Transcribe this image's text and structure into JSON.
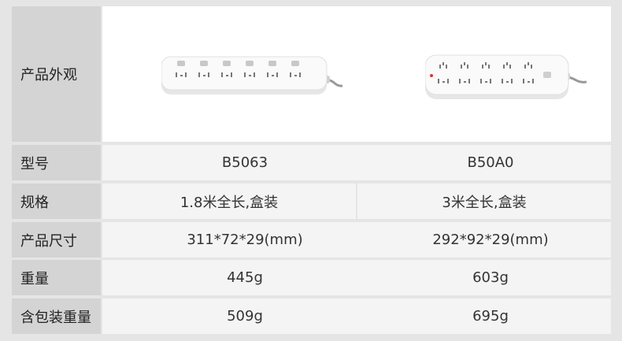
{
  "table": {
    "appearance_label": "产品外观",
    "rows": [
      {
        "label": "型号",
        "value": "B5063",
        "value2": "B50A0"
      },
      {
        "label": "规格",
        "value": "1.8米全长,盒装",
        "value2": "3米全长,盒装"
      },
      {
        "label": "产品尺寸",
        "value": "311*72*29(mm)",
        "value2": "292*92*29(mm)"
      },
      {
        "label": "重量",
        "value": "445g",
        "value2": "603g"
      },
      {
        "label": "含包装重量",
        "value": "509g",
        "value2": "695g"
      }
    ]
  },
  "products": [
    {
      "image": "power-strip-6-outlets-with-switches"
    },
    {
      "image": "power-strip-10-outlets-single-switch"
    }
  ],
  "colors": {
    "label_bg": "#d4d4d4",
    "cell_bg": "#f4f4f4",
    "page_bg": "#e5e5e5"
  }
}
